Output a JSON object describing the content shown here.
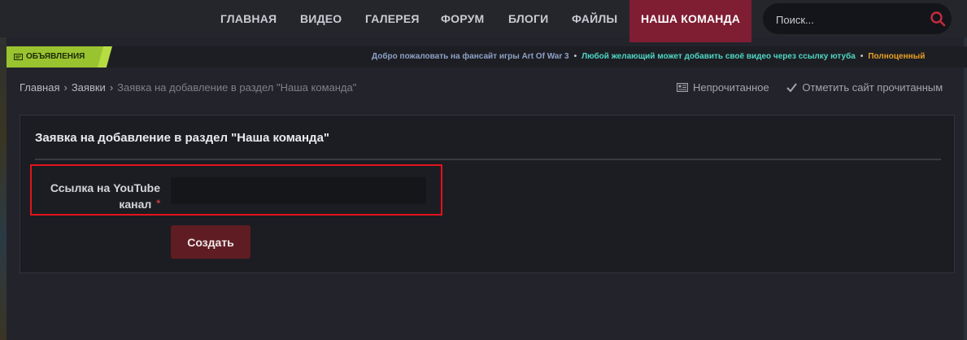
{
  "nav": {
    "items": [
      {
        "label": "ГЛАВНАЯ"
      },
      {
        "label": "ВИДЕО"
      },
      {
        "label": "ГАЛЕРЕЯ"
      },
      {
        "label": "ФОРУМ"
      },
      {
        "label": "БЛОГИ"
      },
      {
        "label": "ФАЙЛЫ"
      },
      {
        "label": "НАША КОМАНДА"
      }
    ],
    "active_color": "#7f1d33",
    "search": {
      "placeholder": "Поиск...",
      "icon": "search-icon",
      "icon_color": "#c42a3f"
    }
  },
  "announcements": {
    "tag_label": "ОБЪЯВЛЕНИЯ",
    "tag_color": "#9ac330",
    "ticker": [
      {
        "text": "Добро пожаловать на фансайт игры Art Of War 3",
        "color": "#8ea1c6"
      },
      {
        "text": "Любой желающий может добавить своё видео через ссылку ютуба",
        "color": "#4fd6c6"
      },
      {
        "text": "Полноценный",
        "color": "#e8a023"
      }
    ],
    "separator": "•"
  },
  "breadcrumb": {
    "items": [
      {
        "label": "Главная"
      },
      {
        "label": "Заявки"
      },
      {
        "label": "Заявка на добавление в раздел \"Наша команда\""
      }
    ],
    "separator": "›"
  },
  "actions": {
    "unread_label": "Непрочитанное",
    "mark_read_label": "Отметить сайт прочитанным"
  },
  "form": {
    "title": "Заявка на добавление в раздел \"Наша команда\"",
    "youtube_label": "Ссылка на YouTube канал",
    "youtube_value": "",
    "required_mark": "*",
    "submit_label": "Создать",
    "highlight_color": "#e2141c"
  }
}
